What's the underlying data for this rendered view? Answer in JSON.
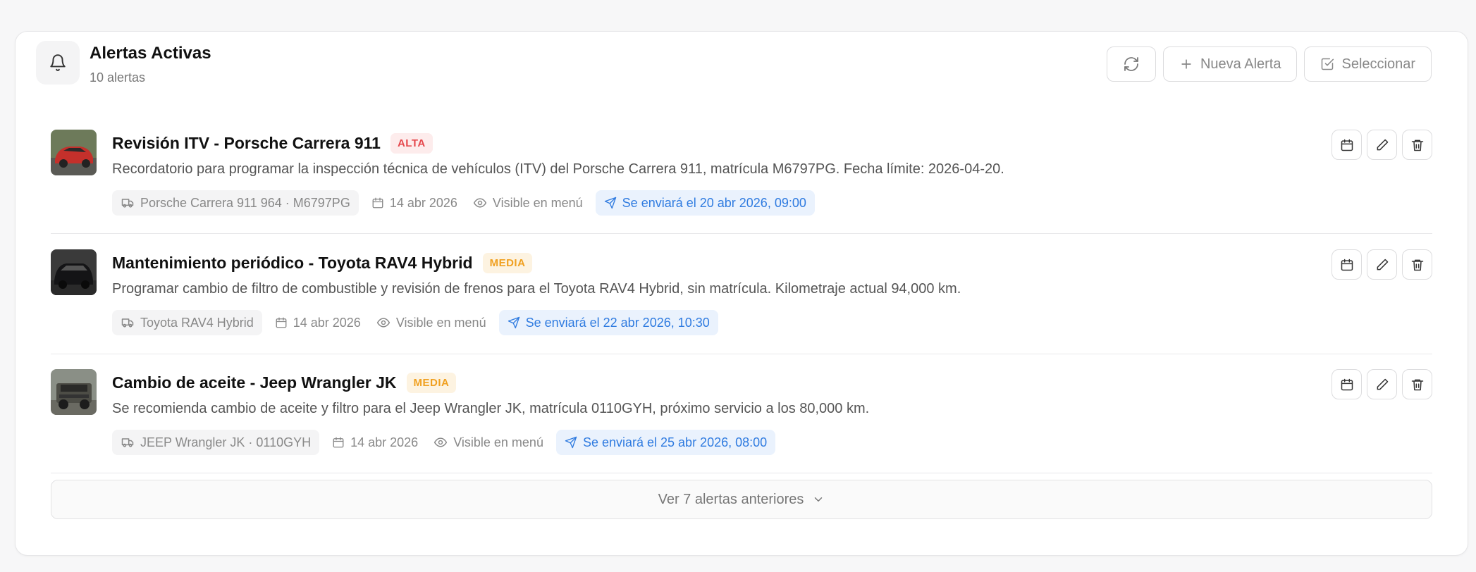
{
  "header": {
    "title": "Alertas Activas",
    "subtitle": "10 alertas",
    "buttons": {
      "refresh_icon": "refresh-icon",
      "new_alert_label": "Nueva Alerta",
      "select_label": "Seleccionar"
    }
  },
  "alerts": [
    {
      "title": "Revisión ITV - Porsche Carrera 911",
      "priority": "ALTA",
      "description": "Recordatorio para programar la inspección técnica de vehículos (ITV) del Porsche Carrera 911, matrícula M6797PG. Fecha límite: 2026-04-20.",
      "vehicle": "Porsche Carrera 911 964 · M6797PG",
      "date": "14 abr 2026",
      "visibility": "Visible en menú",
      "schedule": "Se enviará el 20 abr 2026, 09:00",
      "thumb_color": "#c4302b"
    },
    {
      "title": "Mantenimiento periódico - Toyota RAV4 Hybrid",
      "priority": "MEDIA",
      "description": "Programar cambio de filtro de combustible y revisión de frenos para el Toyota RAV4 Hybrid, sin matrícula. Kilometraje actual 94,000 km.",
      "vehicle": "Toyota RAV4 Hybrid",
      "date": "14 abr 2026",
      "visibility": "Visible en menú",
      "schedule": "Se enviará el 22 abr 2026, 10:30",
      "thumb_color": "#1e1e22"
    },
    {
      "title": "Cambio de aceite - Jeep Wrangler JK",
      "priority": "MEDIA",
      "description": "Se recomienda cambio de aceite y filtro para el Jeep Wrangler JK, matrícula 0110GYH, próximo servicio a los 80,000 km.",
      "vehicle": "JEEP Wrangler JK · 0110GYH",
      "date": "14 abr 2026",
      "visibility": "Visible en menú",
      "schedule": "Se enviará el 25 abr 2026, 08:00",
      "thumb_color": "#5a5a52"
    }
  ],
  "footer": {
    "more_label": "Ver 7 alertas anteriores"
  },
  "colors": {
    "alta": "#e5484d",
    "media": "#f0a020",
    "schedule_blue": "#2f7be0"
  }
}
